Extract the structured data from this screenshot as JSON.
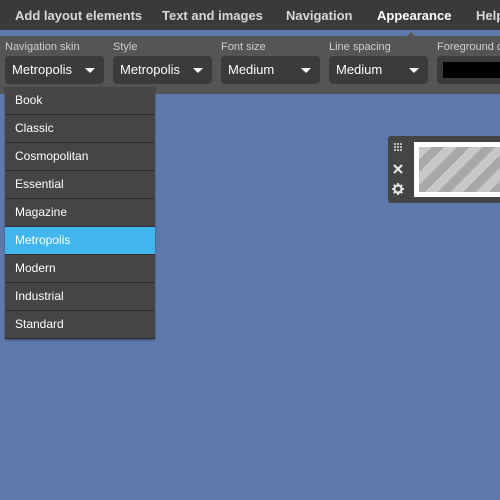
{
  "topbar": {
    "tabs": [
      {
        "label": "Add layout elements"
      },
      {
        "label": "Text and images"
      },
      {
        "label": "Navigation"
      },
      {
        "label": "Appearance"
      },
      {
        "label": "Help"
      }
    ],
    "active_tab": "Appearance"
  },
  "options": {
    "navigation_skin": {
      "label": "Navigation skin",
      "value": "Metropolis"
    },
    "style": {
      "label": "Style",
      "value": "Metropolis"
    },
    "font_size": {
      "label": "Font size",
      "value": "Medium"
    },
    "line_spacing": {
      "label": "Line spacing",
      "value": "Medium"
    },
    "foreground": {
      "label": "Foreground c",
      "color": "#000000"
    }
  },
  "dropdown": {
    "items": [
      "Book",
      "Classic",
      "Cosmopolitan",
      "Essential",
      "Magazine",
      "Metropolis",
      "Modern",
      "Industrial",
      "Standard"
    ],
    "selected": "Metropolis"
  },
  "widget": {
    "tools": [
      "drag-handle-icon",
      "close-icon",
      "gear-icon"
    ]
  },
  "colors": {
    "canvas": "#5e79ad",
    "topbar": "#3a3a3a",
    "optbar": "#555555",
    "selected": "#40b6ec"
  }
}
